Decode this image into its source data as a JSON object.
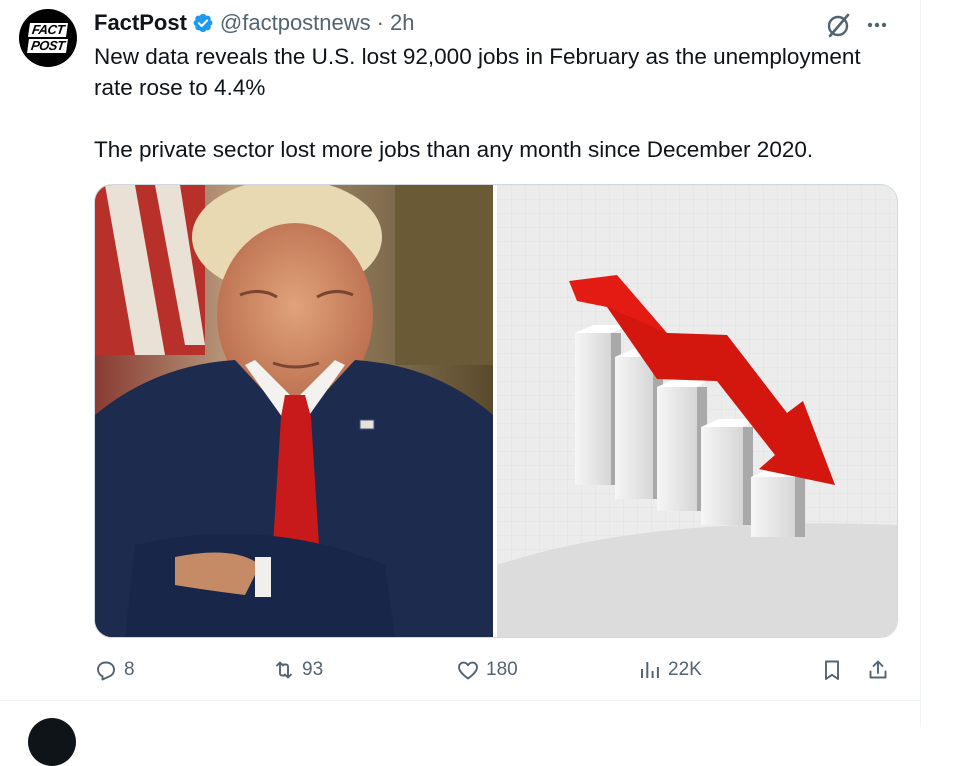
{
  "post": {
    "display_name": "FactPost",
    "handle": "@factpostnews",
    "separator": "·",
    "time": "2h",
    "avatar_lines": [
      "FACT",
      "POST"
    ],
    "text_paragraphs": [
      "New data reveals the U.S. lost 92,000 jobs in February as the unemployment rate rose to 4.4%",
      "The private sector lost more jobs than any month since December 2020."
    ]
  },
  "media": [
    {
      "kind": "photo",
      "subject": "man-in-suit-arms-crossed"
    },
    {
      "kind": "illustration",
      "subject": "declining-bar-chart-with-red-arrow"
    }
  ],
  "actions": {
    "replies": "8",
    "reposts": "93",
    "likes": "180",
    "views": "22K"
  },
  "colors": {
    "text": "#0f1419",
    "secondary": "#536471",
    "verified": "#1d9bf0",
    "divider": "#eff3f4",
    "arrow_red": "#e31b12",
    "tie_red": "#c81a1a",
    "suit_navy": "#1d2b4f"
  },
  "icons": {
    "verified": "verified-badge-icon",
    "grok": "grok-icon",
    "more": "more-icon",
    "reply": "reply-icon",
    "repost": "repost-icon",
    "like": "like-icon",
    "views": "views-icon",
    "bookmark": "bookmark-icon",
    "share": "share-icon"
  }
}
